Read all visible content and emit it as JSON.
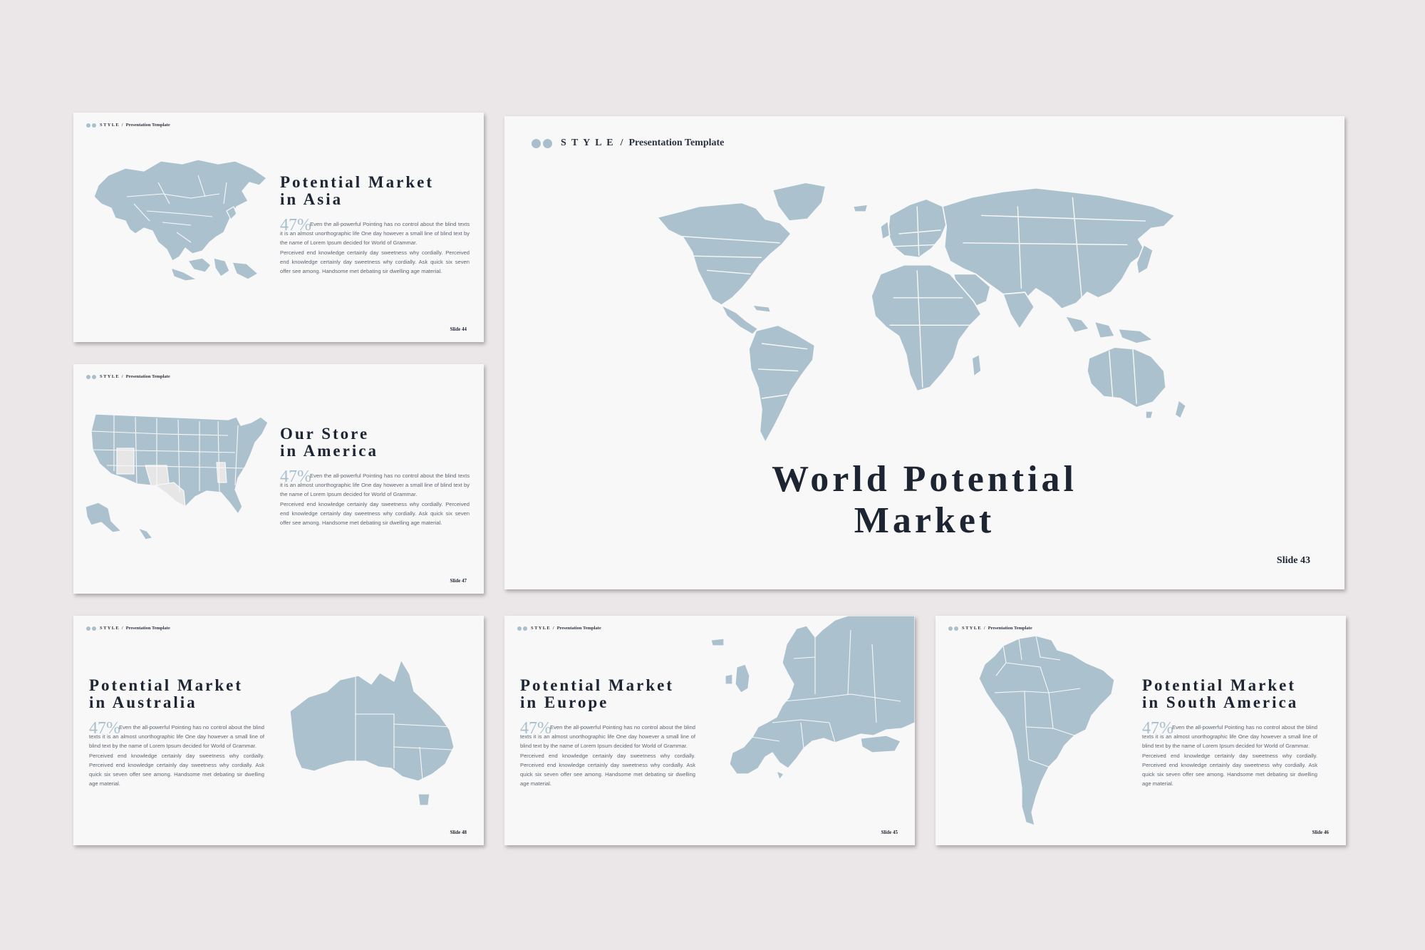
{
  "brand": {
    "name": "S T Y L E",
    "separator": "/",
    "subtitle": "Presentation Template"
  },
  "colors": {
    "background": "#ebe6e7",
    "slide": "#f8f8f8",
    "map": "#abc1cd",
    "title": "#1d2533",
    "accent": "#a9bfcc"
  },
  "body_text": {
    "line1": "Even the all-powerful Pointing has no control about the blind texts it is an almost unorthographic life One day however a small line of blind text by the name of Lorem Ipsum decided for World of Grammar.",
    "line2": "Perceived end knowledge certainly day sweetness why cordially. Perceived end knowledge certainly day sweetness why cordially. Ask quick six seven offer see among. Handsome met debating sir dwelling age material."
  },
  "slides": {
    "asia": {
      "title_line1": "Potential Market",
      "title_line2": "in Asia",
      "percent": "47%",
      "slide_number": "Slide 44",
      "map_icon": "asia-map-icon"
    },
    "america": {
      "title_line1": "Our Store",
      "title_line2": "in America",
      "percent": "47%",
      "slide_number": "Slide 47",
      "map_icon": "usa-map-icon"
    },
    "world": {
      "title_line1": "World Potential",
      "title_line2": "Market",
      "slide_number": "Slide 43",
      "map_icon": "world-map-icon"
    },
    "australia": {
      "title_line1": "Potential Market",
      "title_line2": "in Australia",
      "percent": "47%",
      "slide_number": "Slide 48",
      "map_icon": "australia-map-icon"
    },
    "europe": {
      "title_line1": "Potential Market",
      "title_line2": "in Europe",
      "percent": "47%",
      "slide_number": "Slide 45",
      "map_icon": "europe-map-icon"
    },
    "south_america": {
      "title_line1": "Potential Market",
      "title_line2": "in South America",
      "percent": "47%",
      "slide_number": "Slide 46",
      "map_icon": "south-america-map-icon"
    }
  }
}
